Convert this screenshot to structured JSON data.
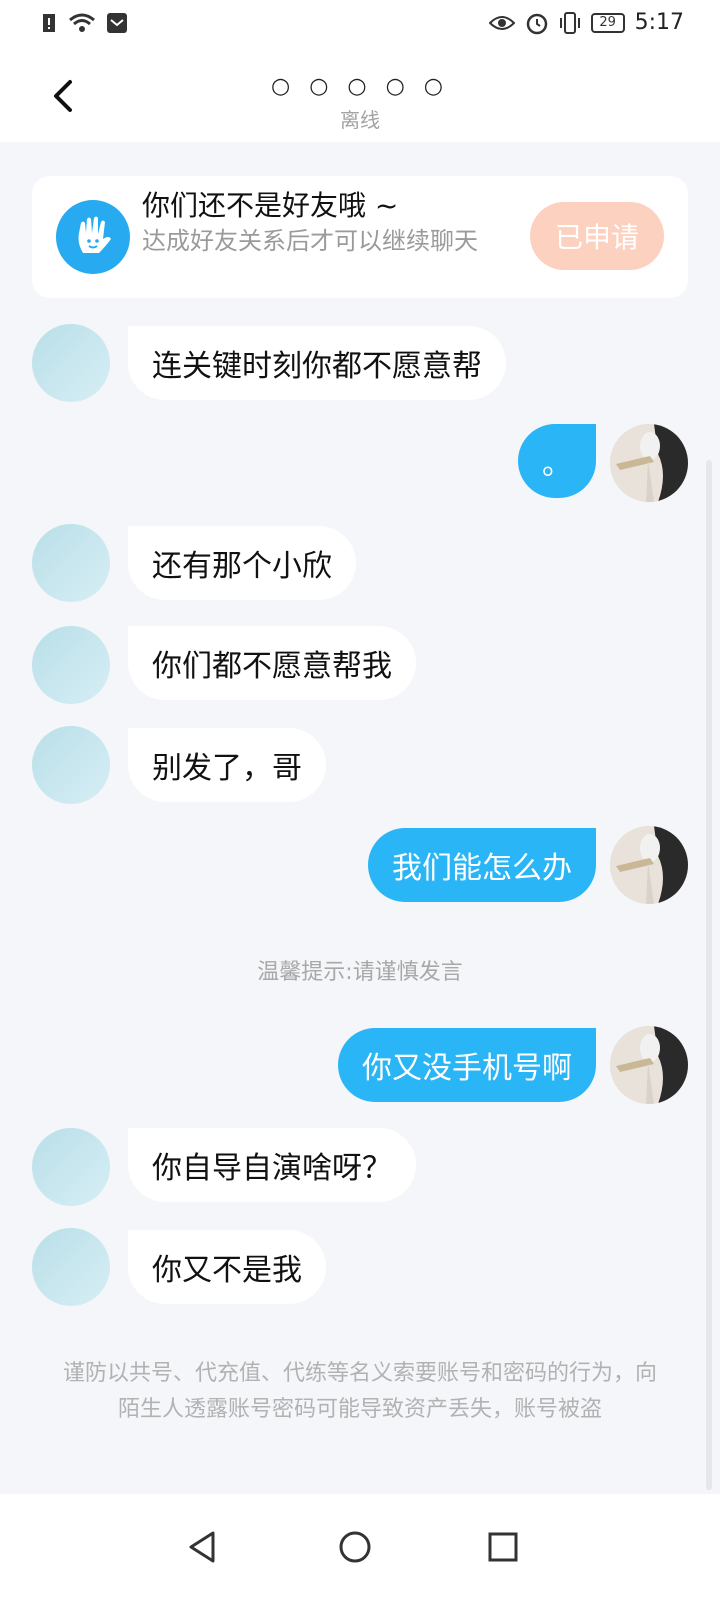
{
  "status_bar": {
    "time": "5:17",
    "battery": "29"
  },
  "header": {
    "title": "○ ○ ○ ○ ○",
    "status": "离线"
  },
  "friend_notice": {
    "title": "你们还不是好友哦 ~",
    "description": "达成好友关系后才可以继续聊天",
    "button": "已申请"
  },
  "messages": [
    {
      "side": "left",
      "text": "连关键时刻你都不愿意帮"
    },
    {
      "side": "right",
      "text": "。"
    },
    {
      "side": "left",
      "text": "还有那个小欣"
    },
    {
      "side": "left",
      "text": "你们都不愿意帮我"
    },
    {
      "side": "left",
      "text": "别发了，哥"
    },
    {
      "side": "right",
      "text": "我们能怎么办"
    },
    {
      "side": "right",
      "text": "你又没手机号啊"
    },
    {
      "side": "left",
      "text": "你自导自演啥呀？"
    },
    {
      "side": "left",
      "text": "你又不是我"
    }
  ],
  "tip": "温馨提示:请谨慎发言",
  "warning": "谨防以共号、代充值、代练等名义索要账号和密码的行为，向陌生人透露账号密码可能导致资产丢失，账号被盗",
  "icons": {
    "back": "chevron-left-icon",
    "hand": "hand-wave-icon",
    "nav_back": "triangle-back-icon",
    "nav_home": "circle-home-icon",
    "nav_recent": "square-recent-icon"
  },
  "colors": {
    "accent": "#2ab5f7",
    "applied": "#fdd1bf"
  }
}
